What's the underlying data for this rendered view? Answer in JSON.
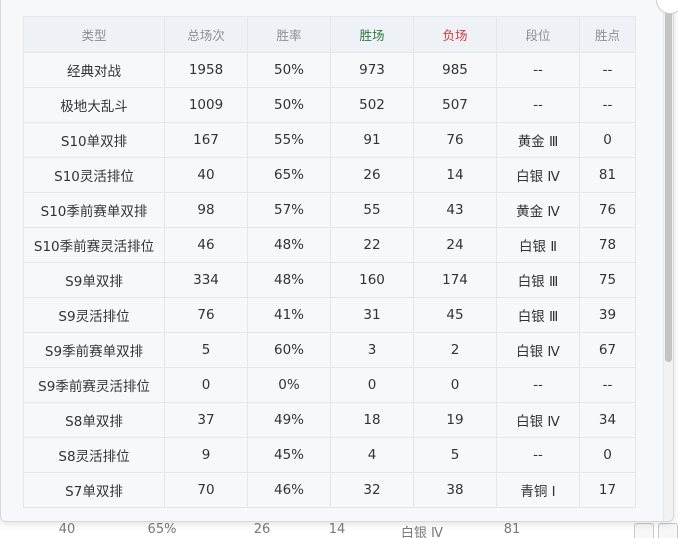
{
  "table": {
    "headers": {
      "type": "类型",
      "total": "总场次",
      "winrate": "胜率",
      "wins": "胜场",
      "losses": "负场",
      "rank": "段位",
      "points": "胜点"
    },
    "rows": [
      {
        "type": "经典对战",
        "total": "1958",
        "winrate": "50%",
        "wins": "973",
        "losses": "985",
        "rank": "--",
        "points": "--"
      },
      {
        "type": "极地大乱斗",
        "total": "1009",
        "winrate": "50%",
        "wins": "502",
        "losses": "507",
        "rank": "--",
        "points": "--"
      },
      {
        "type": "S10单双排",
        "total": "167",
        "winrate": "55%",
        "wins": "91",
        "losses": "76",
        "rank": "黄金 Ⅲ",
        "points": "0"
      },
      {
        "type": "S10灵活排位",
        "total": "40",
        "winrate": "65%",
        "wins": "26",
        "losses": "14",
        "rank": "白银 Ⅳ",
        "points": "81"
      },
      {
        "type": "S10季前赛单双排",
        "total": "98",
        "winrate": "57%",
        "wins": "55",
        "losses": "43",
        "rank": "黄金 Ⅳ",
        "points": "76"
      },
      {
        "type": "S10季前赛灵活排位",
        "total": "46",
        "winrate": "48%",
        "wins": "22",
        "losses": "24",
        "rank": "白银 Ⅱ",
        "points": "78"
      },
      {
        "type": "S9单双排",
        "total": "334",
        "winrate": "48%",
        "wins": "160",
        "losses": "174",
        "rank": "白银 Ⅲ",
        "points": "75"
      },
      {
        "type": "S9灵活排位",
        "total": "76",
        "winrate": "41%",
        "wins": "31",
        "losses": "45",
        "rank": "白银 Ⅲ",
        "points": "39"
      },
      {
        "type": "S9季前赛单双排",
        "total": "5",
        "winrate": "60%",
        "wins": "3",
        "losses": "2",
        "rank": "白银 Ⅳ",
        "points": "67"
      },
      {
        "type": "S9季前赛灵活排位",
        "total": "0",
        "winrate": "0%",
        "wins": "0",
        "losses": "0",
        "rank": "--",
        "points": "--"
      },
      {
        "type": "S8单双排",
        "total": "37",
        "winrate": "49%",
        "wins": "18",
        "losses": "19",
        "rank": "白银 Ⅳ",
        "points": "34"
      },
      {
        "type": "S8灵活排位",
        "total": "9",
        "winrate": "45%",
        "wins": "4",
        "losses": "5",
        "rank": "--",
        "points": "0"
      },
      {
        "type": "S7单双排",
        "total": "70",
        "winrate": "46%",
        "wins": "32",
        "losses": "38",
        "rank": "青铜 Ⅰ",
        "points": "17"
      }
    ]
  },
  "background_row": {
    "total": "40",
    "winrate": "65%",
    "wins": "26",
    "losses": "14",
    "rank": "白银 Ⅳ",
    "points": "81"
  },
  "colors": {
    "win_header": "#2b7a3e",
    "loss_header": "#d43a3a",
    "header_bg": "#eef2f7",
    "body_bg": "#f6f8fa"
  }
}
